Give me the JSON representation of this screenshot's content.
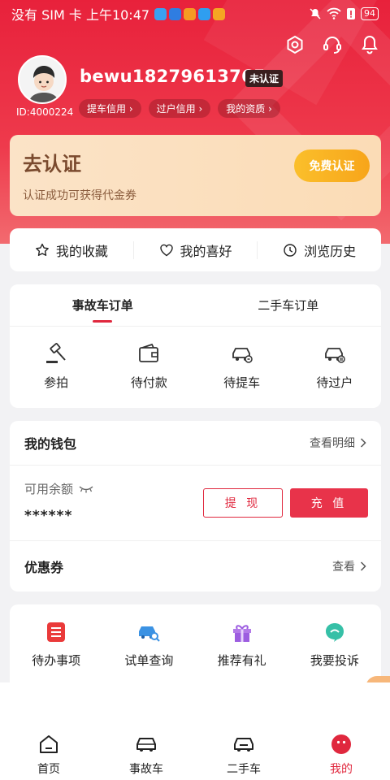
{
  "status_bar": {
    "left": "没有 SIM 卡 上午10:47",
    "battery": "94"
  },
  "profile": {
    "username": "bewu18279613765",
    "id_label": "ID:4000224",
    "badge": "未认证",
    "pills": [
      "提车信用 ›",
      "过户信用 ›",
      "我的资质 ›"
    ]
  },
  "verify": {
    "title": "去认证",
    "subtitle": "认证成功可获得代金券",
    "button": "免费认证"
  },
  "quick_links": [
    "我的收藏",
    "我的喜好",
    "浏览历史"
  ],
  "orders": {
    "tabs": [
      "事故车订单",
      "二手车订单"
    ],
    "items": [
      "参拍",
      "待付款",
      "待提车",
      "待过户"
    ]
  },
  "wallet": {
    "title": "我的钱包",
    "detail_link": "查看明细",
    "balance_label": "可用余额",
    "balance_value": "******",
    "withdraw": "提 现",
    "recharge": "充 值",
    "coupon_label": "优惠券",
    "coupon_link": "查看"
  },
  "services": [
    "待办事项",
    "试单查询",
    "推荐有礼",
    "我要投诉"
  ],
  "bottom_nav": [
    "首页",
    "事故车",
    "二手车",
    "我的"
  ],
  "colors": {
    "brand_red": "#e0283e",
    "gold": "#f7a51a"
  }
}
